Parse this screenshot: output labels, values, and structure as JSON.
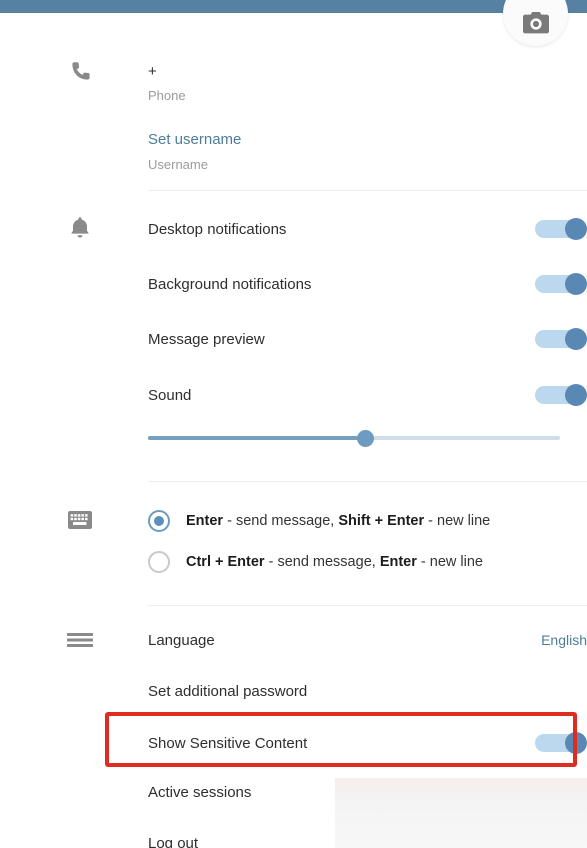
{
  "window": {
    "header_color": "#5681a3",
    "background": "#ffffff"
  },
  "avatar": {
    "icon": "camera-icon"
  },
  "sections": {
    "profile": {
      "icon": "phone-icon",
      "phone_value": "+",
      "phone_label": "Phone",
      "username_link": "Set username",
      "username_label": "Username"
    },
    "notifications": {
      "icon": "bell-icon",
      "items": [
        {
          "label": "Desktop notifications",
          "toggle": "on"
        },
        {
          "label": "Background notifications",
          "toggle": "on"
        },
        {
          "label": "Message preview",
          "toggle": "on"
        },
        {
          "label": "Sound",
          "toggle": "on"
        }
      ],
      "volume_slider": {
        "name": "volume-slider",
        "value_percent": 53
      }
    },
    "keyboard": {
      "icon": "keyboard-icon",
      "options": [
        {
          "selected": true,
          "parts": [
            {
              "text": "Enter",
              "bold": true
            },
            {
              "text": " - send message, ",
              "bold": false
            },
            {
              "text": "Shift + Enter",
              "bold": true
            },
            {
              "text": " - new line",
              "bold": false
            }
          ]
        },
        {
          "selected": false,
          "parts": [
            {
              "text": "Ctrl + Enter",
              "bold": true
            },
            {
              "text": " - send message, ",
              "bold": false
            },
            {
              "text": "Enter",
              "bold": true
            },
            {
              "text": " - new line",
              "bold": false
            }
          ]
        }
      ]
    },
    "general": {
      "icon": "hamburger-menu-icon",
      "language_label": "Language",
      "language_value": "English",
      "password_label": "Set additional password",
      "sensitive_label": "Show Sensitive Content",
      "sensitive_toggle": "on",
      "sessions_label": "Active sessions",
      "logout_label": "Log out"
    }
  },
  "annotation": {
    "highlight_color": "#e02b20",
    "highlight_target": "Show Sensitive Content"
  },
  "colors": {
    "accent_blue": "#5681a3",
    "toggle_track": "#bcd8ee",
    "toggle_knob": "#5a88b4",
    "link": "#4d7d99",
    "muted_text": "#9b9b9b"
  }
}
